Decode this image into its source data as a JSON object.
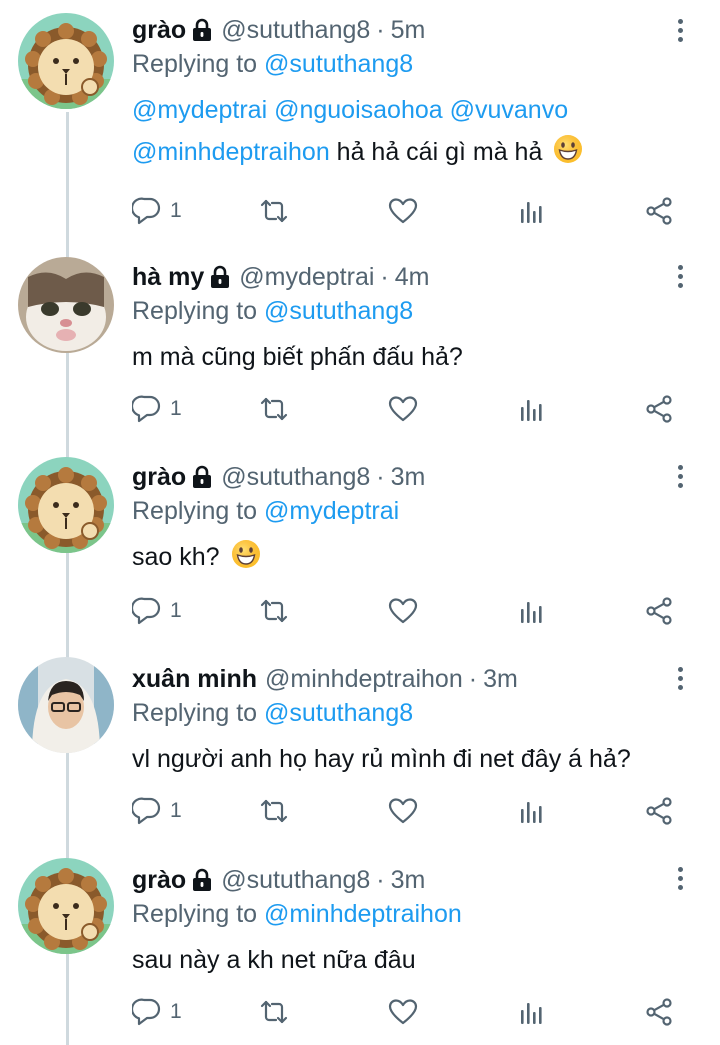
{
  "tweets": [
    {
      "name": "grào",
      "handle": "@sututhang8",
      "time": "5m",
      "replying_label": "Replying to",
      "replying_to": "@sututhang8",
      "text_mentions": "@mydeptrai @nguoisaohoa @vuvanvo @minhdeptraihon",
      "text": "hả hả cái gì mà hả",
      "emoji": "grinning-face",
      "reply_count": "1",
      "locked": true,
      "avatar": "lion-cartoon"
    },
    {
      "name": "hà my",
      "handle": "@mydeptrai",
      "time": "4m",
      "replying_label": "Replying to",
      "replying_to": "@sututhang8",
      "text": "m mà cũng biết phấn đấu hả?",
      "reply_count": "1",
      "locked": true,
      "avatar": "cat-photo"
    },
    {
      "name": "grào",
      "handle": "@sututhang8",
      "time": "3m",
      "replying_label": "Replying to",
      "replying_to": "@mydeptrai",
      "text": "sao kh?",
      "emoji": "grinning-face",
      "reply_count": "1",
      "locked": true,
      "avatar": "lion-cartoon"
    },
    {
      "name": "xuân minh",
      "handle": "@minhdeptraihon",
      "time": "3m",
      "replying_label": "Replying to",
      "replying_to": "@sututhang8",
      "text": "vl người anh họ hay rủ mình đi net đây á hả?",
      "reply_count": "1",
      "locked": false,
      "avatar": "person-photo"
    },
    {
      "name": "grào",
      "handle": "@sututhang8",
      "time": "3m",
      "replying_label": "Replying to",
      "replying_to": "@minhdeptraihon",
      "text": "sau này a kh net nữa đâu",
      "reply_count": "1",
      "locked": true,
      "avatar": "lion-cartoon"
    }
  ],
  "separator": "·",
  "icons": [
    "reply-icon",
    "retweet-icon",
    "like-icon",
    "analytics-icon",
    "share-icon",
    "more-options-icon",
    "lock-icon"
  ],
  "colors": {
    "accent": "#1d9bf0",
    "secondary_text": "#536471",
    "thread_line": "#cfd9de"
  }
}
